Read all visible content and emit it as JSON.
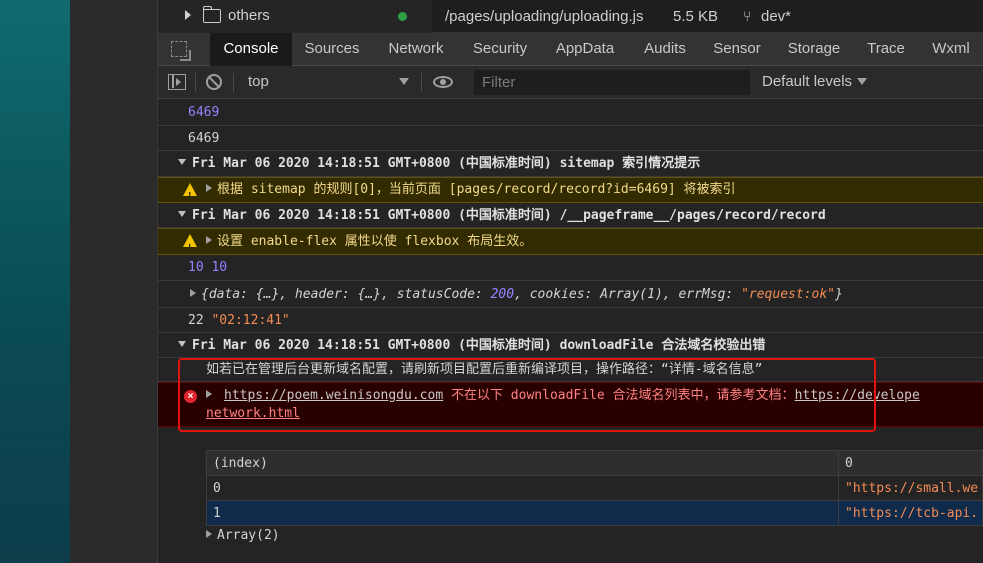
{
  "file_bar": {
    "tree_label": "others",
    "file_path": "/pages/uploading/uploading.js",
    "file_size": "5.5 KB",
    "branch": "dev*",
    "status_color": "#2ea043"
  },
  "tabs": [
    "Console",
    "Sources",
    "Network",
    "Security",
    "AppData",
    "Audits",
    "Sensor",
    "Storage",
    "Trace",
    "Wxml"
  ],
  "active_tab": "Console",
  "toolbar": {
    "context": "top",
    "filter_placeholder": "Filter",
    "levels": "Default levels"
  },
  "console": {
    "log1": "6469",
    "log2": "6469",
    "group1": "Fri Mar 06 2020 14:18:51 GMT+0800 (中国标准时间) sitemap 索引情况提示",
    "warn1": "根据 sitemap 的规则[0]，当前页面 [pages/record/record?id=6469] 将被索引",
    "group2": "Fri Mar 06 2020 14:18:51 GMT+0800 (中国标准时间) /__pageframe__/pages/record/record",
    "warn2_pre": "设置 ",
    "warn2_code1": "enable-flex",
    "warn2_mid": " 属性以使 ",
    "warn2_code2": "flexbox",
    "warn2_post": " 布局生效。",
    "log3": "10 10",
    "obj_open": "{data: {…}, header: {…}, statusCode: ",
    "obj_status": "200",
    "obj_mid": ", cookies: Array(1), errMsg: ",
    "obj_errmsg": "\"request:ok\"",
    "obj_close": "}",
    "log4_num": "22",
    "log4_str": "\"02:12:41\"",
    "group3": "Fri Mar 06 2020 14:18:51 GMT+0800 (中国标准时间) downloadFile 合法域名校验出错",
    "info": "如若已在管理后台更新域名配置，请刷新项目配置后重新编译项目，操作路径：“详情-域名信息”",
    "err_url": "https://poem.weinisongdu.com",
    "err_text": " 不在以下 downloadFile 合法域名列表中，请参考文档：",
    "err_doc": "https://develope",
    "err_doc2": "network.html",
    "error_icon": "×"
  },
  "table": {
    "headers": [
      "(index)",
      "0"
    ],
    "rows": [
      {
        "index": "0",
        "value": "\"https://small.we"
      },
      {
        "index": "1",
        "value": "\"https://tcb-api."
      }
    ]
  },
  "array_label": "Array(2)"
}
